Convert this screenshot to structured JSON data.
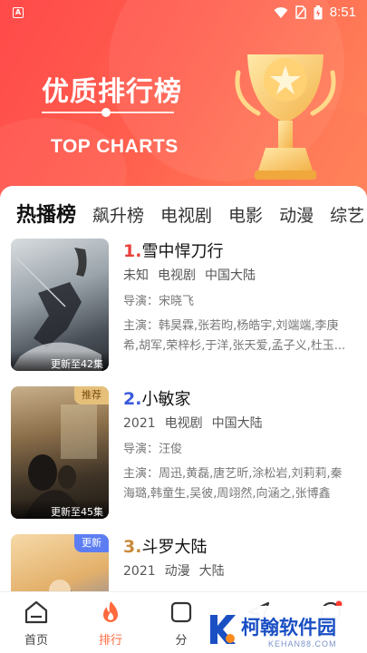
{
  "status": {
    "time": "8:51"
  },
  "hero": {
    "title": "优质排行榜",
    "subtitle": "TOP CHARTS"
  },
  "tabs": [
    "热播榜",
    "飙升榜",
    "电视剧",
    "电影",
    "动漫",
    "综艺"
  ],
  "items": [
    {
      "rank": "1.",
      "rank_color": "#e8413b",
      "title": "雪中悍刀行",
      "year": "未知",
      "type": "电视剧",
      "region": "中国大陆",
      "director": "导演：宋晓飞",
      "cast": "主演：韩昊霖,张若昀,杨皓宇,刘端端,李庚希,胡军,荣梓杉,于洋,张天爱,孟子义,杜玉...",
      "poster_update": "更新至42集",
      "badge": ""
    },
    {
      "rank": "2.",
      "rank_color": "#3b5bdb",
      "title": "小敏家",
      "year": "2021",
      "type": "电视剧",
      "region": "中国大陆",
      "director": "导演：汪俊",
      "cast": "主演：周迅,黄磊,唐艺昕,涂松岩,刘莉莉,秦海璐,韩童生,吴彼,周翊然,向涵之,张博鑫",
      "poster_update": "更新至45集",
      "badge": "推荐"
    },
    {
      "rank": "3.",
      "rank_color": "#c98a3a",
      "title": "斗罗大陆",
      "year": "2021",
      "type": "动漫",
      "region": "大陆",
      "director": "",
      "cast": "",
      "poster_update": "",
      "badge": "更新"
    }
  ],
  "nav": [
    {
      "label": "首页",
      "icon": "home-icon"
    },
    {
      "label": "排行",
      "icon": "flame-icon",
      "active": true
    },
    {
      "label": "分",
      "icon": "category-icon"
    }
  ],
  "watermark": {
    "text": "柯翰软件园",
    "sub": "KEHAN88.COM"
  }
}
